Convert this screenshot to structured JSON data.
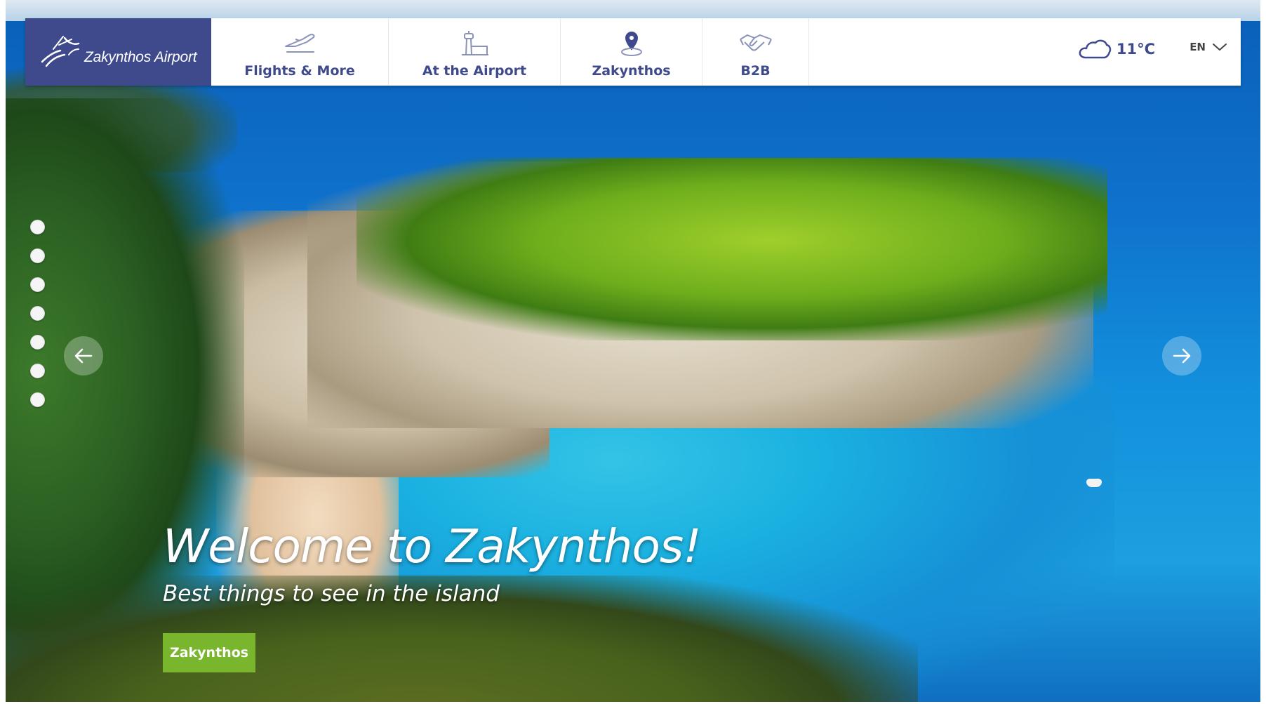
{
  "brand": {
    "name": "Zakynthos Airport",
    "color": "#3f4a8d"
  },
  "nav": {
    "items": [
      {
        "label": "Flights & More",
        "icon": "airplane-takeoff-icon"
      },
      {
        "label": "At the Airport",
        "icon": "control-tower-icon"
      },
      {
        "label": "Zakynthos",
        "icon": "map-pin-icon"
      },
      {
        "label": "B2B",
        "icon": "handshake-icon"
      }
    ]
  },
  "weather": {
    "icon": "cloud-icon",
    "temperature": "11°C"
  },
  "language": {
    "selected": "EN",
    "icon": "chevron-down-icon"
  },
  "slider": {
    "dot_count": 7,
    "prev_icon": "arrow-left-icon",
    "next_icon": "arrow-right-icon"
  },
  "hero": {
    "headline": "Welcome to Zakynthos!",
    "subline": "Best things to see in the island",
    "cta_label": "Zakynthos",
    "cta_color": "#7ab62d"
  }
}
